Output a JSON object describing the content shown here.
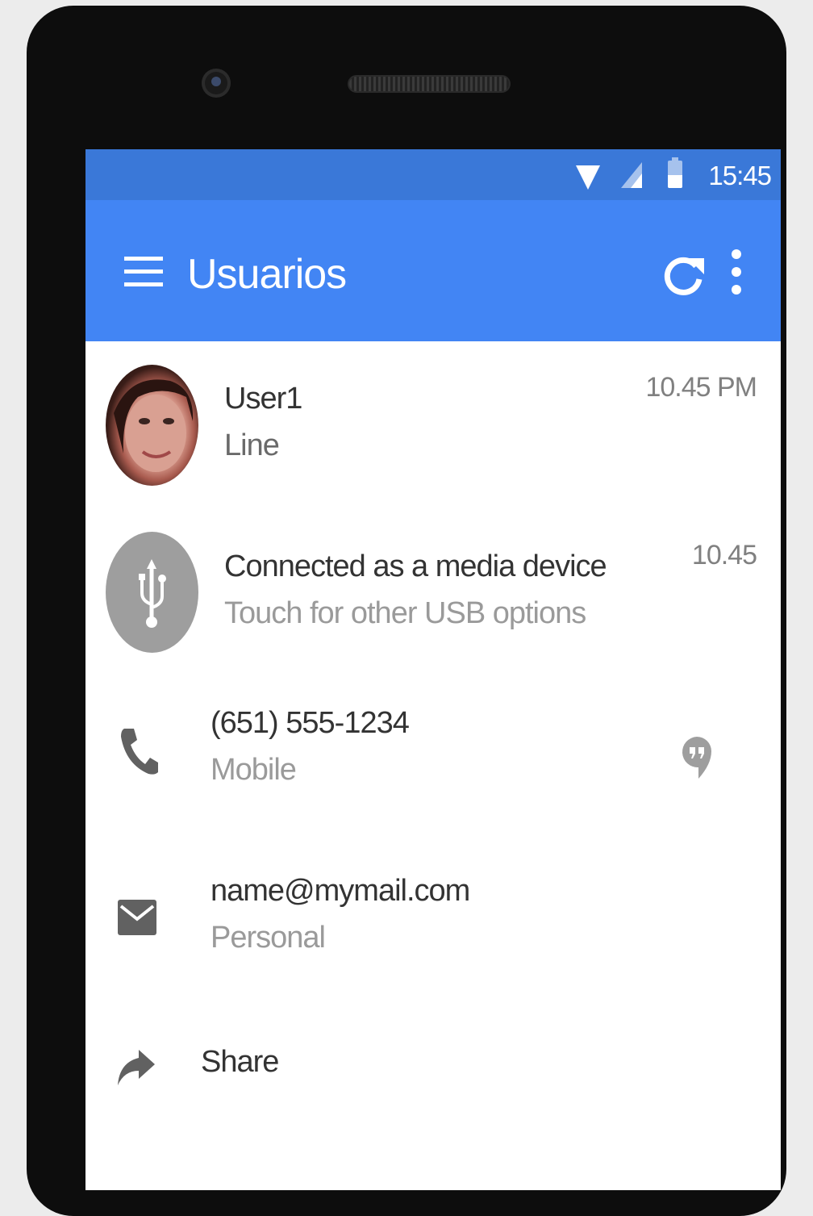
{
  "status_bar": {
    "time": "15:45",
    "icons": [
      "wifi-icon",
      "signal-icon",
      "battery-icon"
    ]
  },
  "app_bar": {
    "title": "Usuarios",
    "icons": [
      "menu-icon",
      "refresh-icon",
      "more-vert-icon"
    ]
  },
  "list": {
    "user": {
      "name": "User1",
      "subtitle": "Line",
      "time": "10.45 PM"
    },
    "notification": {
      "title": "Connected as a media device",
      "subtitle": "Touch for other USB options",
      "time": "10.45",
      "icon": "usb-icon"
    },
    "phone": {
      "number": "(651) 555-1234",
      "label": "Mobile",
      "icon": "phone-icon",
      "action_icon": "hangouts-icon"
    },
    "email": {
      "address": "name@mymail.com",
      "label": "Personal",
      "icon": "email-icon"
    },
    "share": {
      "label": "Share",
      "icon": "share-icon"
    }
  },
  "colors": {
    "app_bar": "#4285f4",
    "status_bar": "#3a78d8",
    "device_frame": "#0d0d0d",
    "icon_gray": "#616161"
  }
}
